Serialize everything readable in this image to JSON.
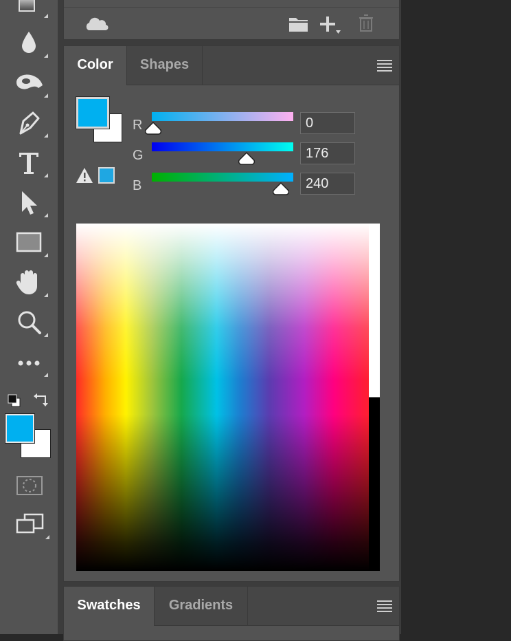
{
  "colors": {
    "foreground": "#00b0f0",
    "background": "#ffffff",
    "toolbar_bg": "#535353",
    "panel_bg": "#535353"
  },
  "toolbar": {
    "tools": [
      {
        "name": "gradient-tool-icon"
      },
      {
        "name": "blur-tool-icon"
      },
      {
        "name": "dodge-tool-icon"
      },
      {
        "name": "pen-tool-icon"
      },
      {
        "name": "type-tool-icon",
        "glyph": "T"
      },
      {
        "name": "path-selection-tool-icon"
      },
      {
        "name": "rectangle-tool-icon"
      },
      {
        "name": "hand-tool-icon"
      },
      {
        "name": "zoom-tool-icon"
      },
      {
        "name": "more-tools-icon",
        "glyph": "•••"
      },
      {
        "name": "default-colors-icon"
      },
      {
        "name": "swap-colors-icon"
      },
      {
        "name": "quick-mask-icon"
      },
      {
        "name": "screen-mode-icon"
      }
    ]
  },
  "layers_footer": {
    "icons": [
      "cloud-icon",
      "folder-icon",
      "new-layer-icon",
      "trash-icon"
    ]
  },
  "color_panel": {
    "tabs": [
      {
        "label": "Color",
        "active": true
      },
      {
        "label": "Shapes",
        "active": false
      }
    ],
    "out_of_gamut_icon": "warning-triangle-icon",
    "sliders": [
      {
        "label": "R",
        "value": "0"
      },
      {
        "label": "G",
        "value": "176"
      },
      {
        "label": "B",
        "value": "240"
      }
    ],
    "brightness_fraction": 0.5
  },
  "bottom_panel": {
    "tabs": [
      {
        "label": "Swatches",
        "active": true
      },
      {
        "label": "Gradients",
        "active": false
      }
    ]
  }
}
